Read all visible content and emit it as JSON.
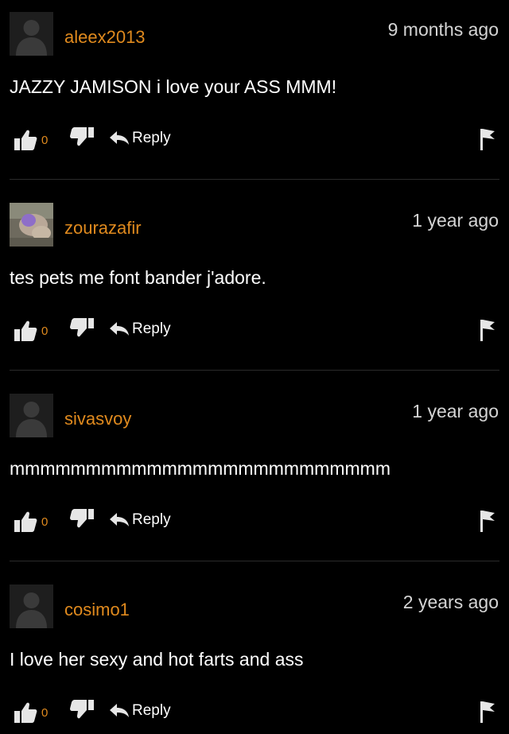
{
  "comments": [
    {
      "username": "aleex2013",
      "time": "9 months ago",
      "text": "JAZZY JAMISON i love your ASS MMM!",
      "likes": "0",
      "reply_label": "Reply",
      "avatar": "default-silhouette"
    },
    {
      "username": "zourazafir",
      "time": "1 year ago",
      "text": "tes pets me font bander j'adore.",
      "likes": "0",
      "reply_label": "Reply",
      "avatar": "photo"
    },
    {
      "username": "sivasvoy",
      "time": "1 year ago",
      "text": "mmmmmmmmmmmmmmmmmmmmmmmmm",
      "likes": "0",
      "reply_label": "Reply",
      "avatar": "default-silhouette"
    },
    {
      "username": "cosimo1",
      "time": "2 years ago",
      "text": "I love her sexy and hot farts and ass",
      "likes": "0",
      "reply_label": "Reply",
      "avatar": "default-silhouette"
    }
  ],
  "colors": {
    "background": "#000000",
    "username": "#e08a1e",
    "text": "#ffffff",
    "timestamp": "#d4d4d4"
  },
  "icons": [
    "thumbs-up-icon",
    "thumbs-down-icon",
    "reply-arrow-icon",
    "flag-icon"
  ]
}
